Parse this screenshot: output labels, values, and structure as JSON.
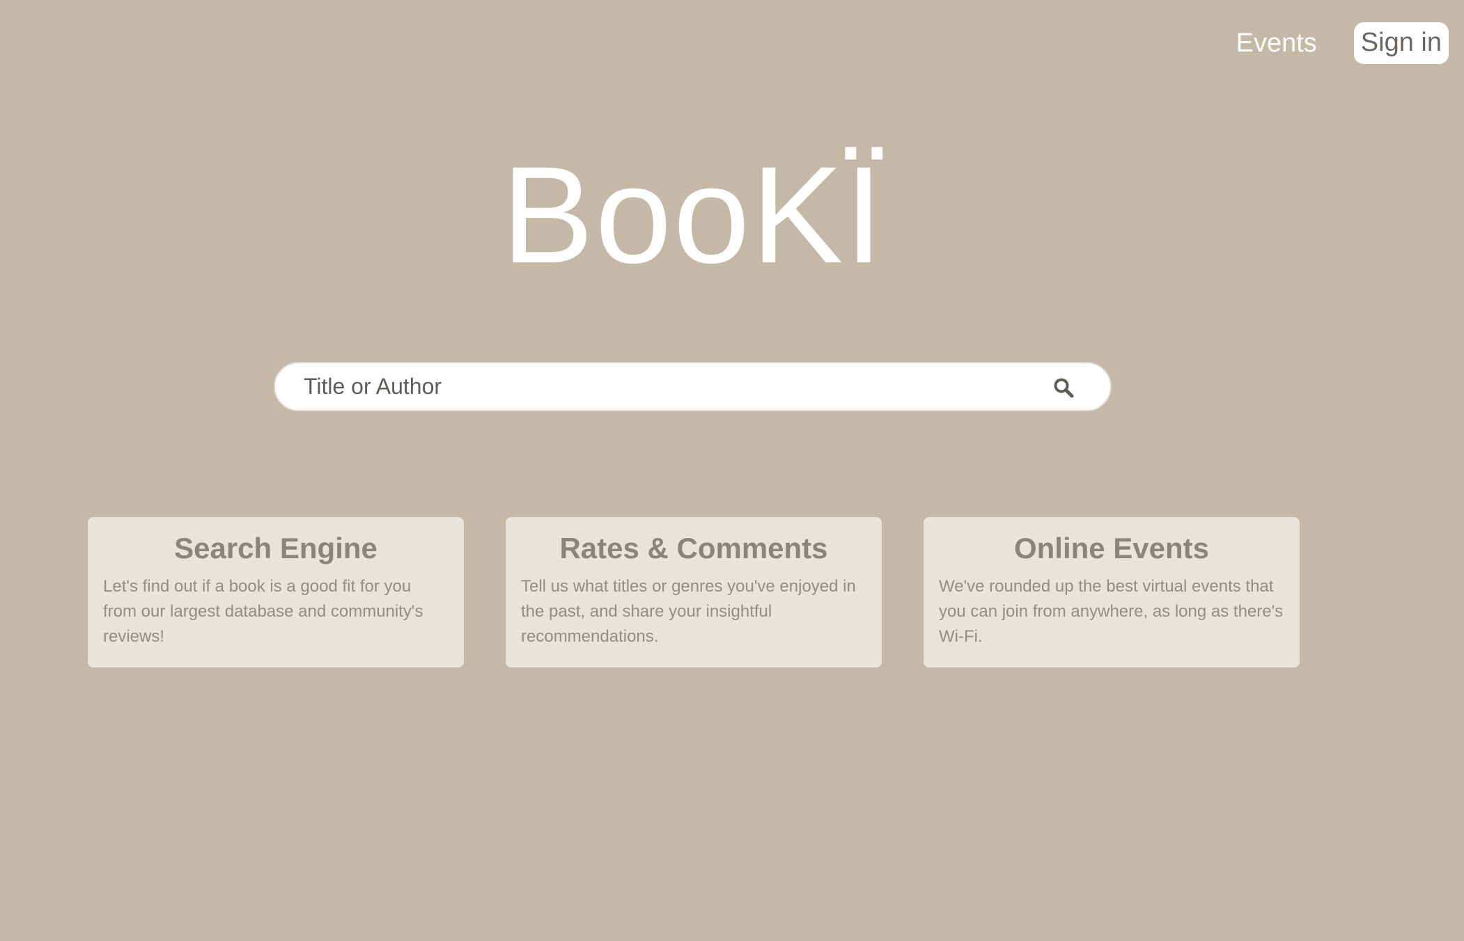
{
  "nav": {
    "events_label": "Events",
    "signin_label": "Sign in"
  },
  "brand": {
    "logo_text": "BooKÏ"
  },
  "search": {
    "placeholder": "Title or Author",
    "icon": "search-icon"
  },
  "features": [
    {
      "title": "Search Engine",
      "text": "Let's find out if a book is a good fit for you from our largest database and community's reviews!"
    },
    {
      "title": "Rates & Comments",
      "text": "Tell us what titles or genres you've enjoyed in the past, and share your insightful recommendations."
    },
    {
      "title": "Online Events",
      "text": "We've rounded up the best virtual events that you can join from anywhere, as long as there's Wi-Fi."
    }
  ],
  "colors": {
    "background": "#c5b8a7",
    "card": "#e8e3dd",
    "card_title": "#8b847d",
    "card_text": "#948d86",
    "logo": "#ffffff"
  }
}
